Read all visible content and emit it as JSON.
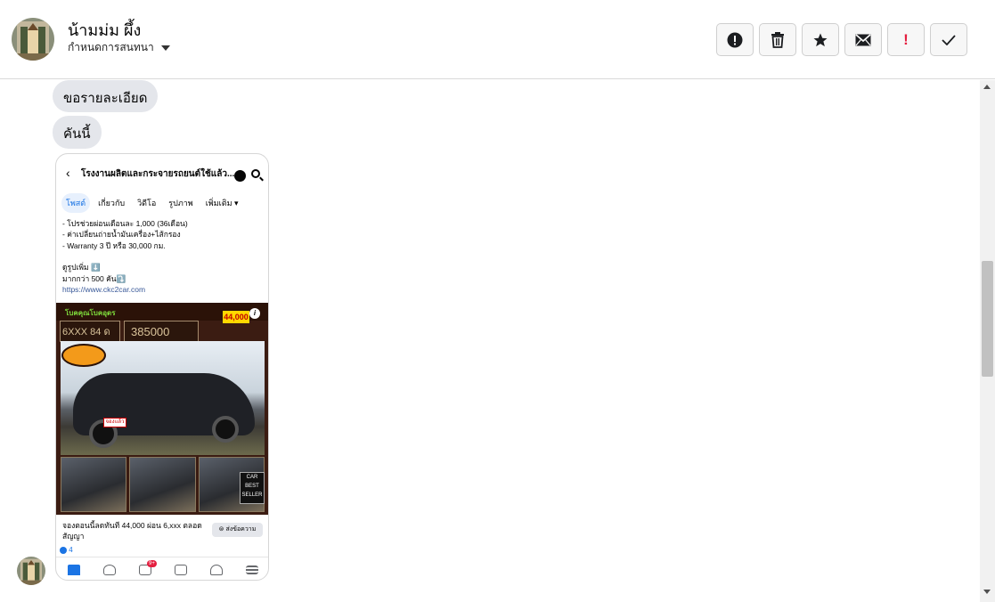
{
  "header": {
    "contact_name": "น้ามม่ม ผึ้ง",
    "subtitle": "กำหนดการสนทนา",
    "actions": [
      {
        "name": "report-icon"
      },
      {
        "name": "trash-icon"
      },
      {
        "name": "star-icon"
      },
      {
        "name": "envelope-icon"
      },
      {
        "name": "exclamation-icon"
      },
      {
        "name": "checkmark-icon"
      }
    ],
    "exclamation_label": "!",
    "accent_red": "#e41e3f"
  },
  "messages": [
    {
      "text": "ขอรายละเอียด"
    },
    {
      "text": "คันนี้"
    }
  ],
  "shared_screenshot": {
    "back_glyph": "‹",
    "page_title": "โรงงานผลิตและกระจายรถยนต์ใช้แล้ว...",
    "tabs": [
      "โพสต์",
      "เกี่ยวกับ",
      "วิดีโอ",
      "รูปภาพ",
      "เพิ่มเติม ▾"
    ],
    "body_lines": [
      "- โปรช่วยผ่อนเดือนละ 1,000 (36เดือน)",
      "- ค่าเปลี่ยนถ่ายน้ำมันเครื่อง+ไส้กรอง",
      "- Warranty 3 ปี หรือ 30,000 กม.",
      "",
      "ดูรูปเพิ่ม ⬇️",
      "มากกว่า 500 คัน⤵️"
    ],
    "link": "https://www.ckc2car.com",
    "ad": {
      "branch": "โบคคุณโบคอุดร",
      "monthly": "6XXX 84 ด",
      "price": "385000",
      "down_badge": "44,000",
      "info": "i",
      "plate": "จองแล้ว",
      "seller_badge": "CAR BEST SELLER"
    },
    "caption": "จองตอนนี้ลดทันที 44,000 ผ่อน 6,xxx ตลอดสัญญา",
    "send_button": "⊜ ส่งข้อความ",
    "reaction_count": "4",
    "nav_badge": "9+"
  }
}
